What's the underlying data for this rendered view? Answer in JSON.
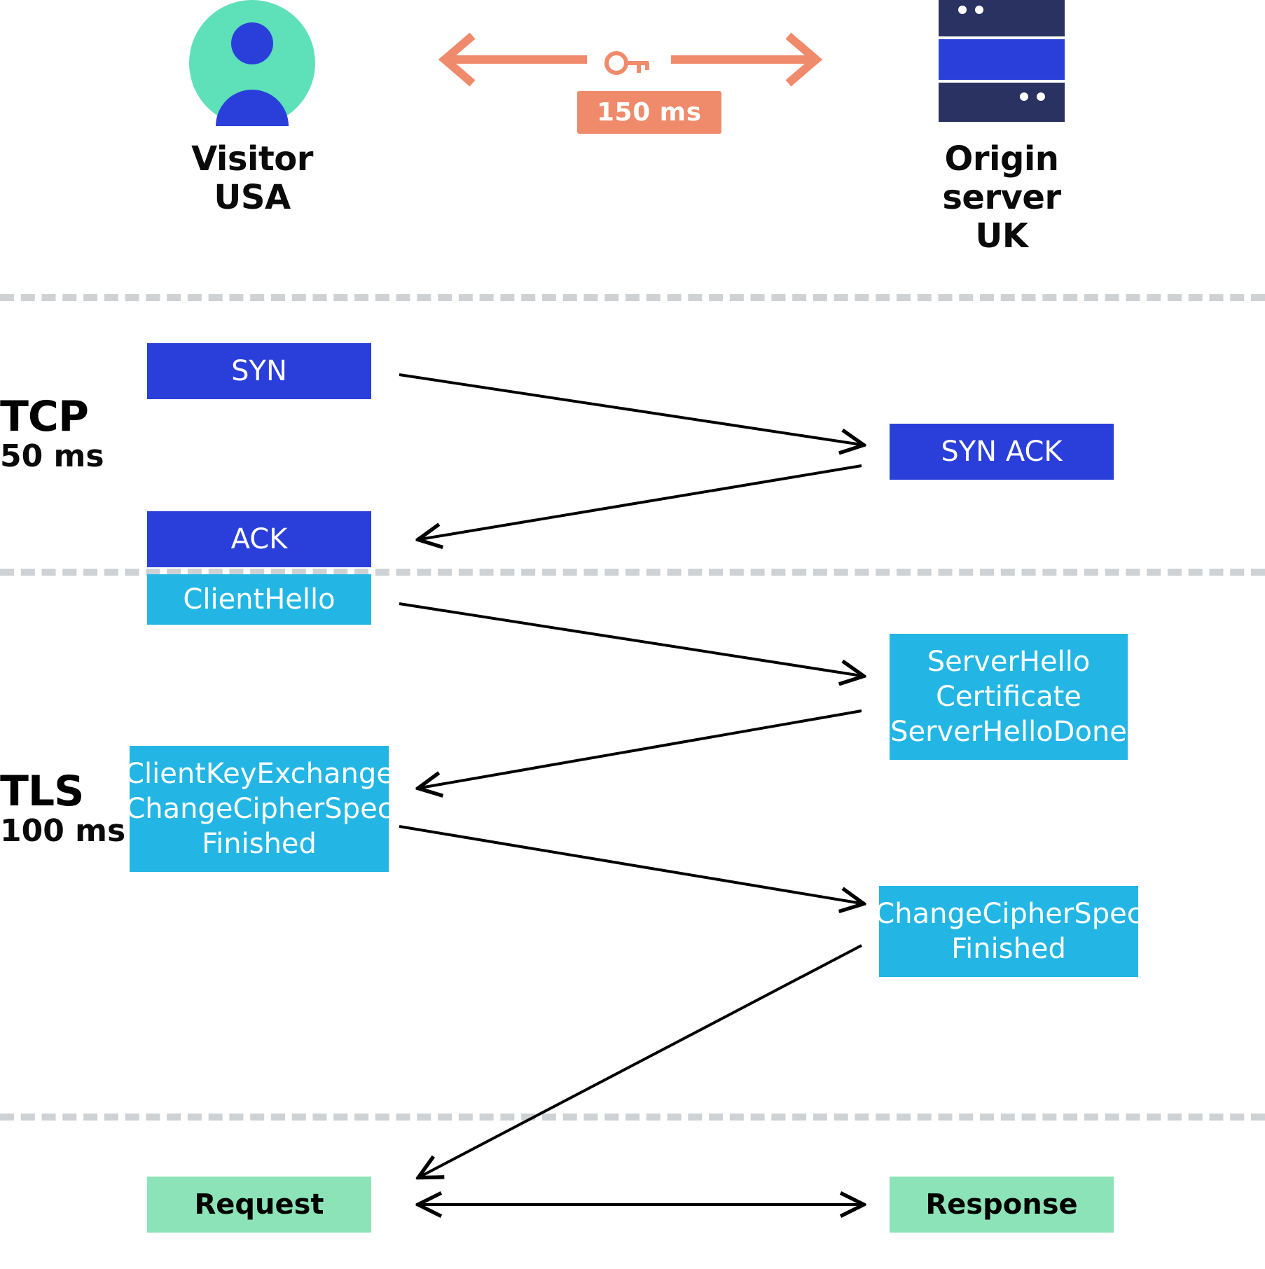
{
  "header": {
    "visitor_label_line1": "Visitor",
    "visitor_label_line2": "USA",
    "origin_label_line1": "Origin server",
    "origin_label_line2": "UK",
    "rtt_label": "150 ms"
  },
  "phases": {
    "tcp": {
      "title": "TCP",
      "time": "50 ms"
    },
    "tls": {
      "title": "TLS",
      "time": "100 ms"
    }
  },
  "messages": {
    "syn": "SYN",
    "synack": "SYN ACK",
    "ack": "ACK",
    "clienthello": "ClientHello",
    "serverhello": "ServerHello\nCertificate\nServerHelloDone",
    "clientkey": "ClientKeyExchange\nChangeCipherSpec\nFinished",
    "serverfinish": "ChangeCipherSpec\nFinished",
    "request": "Request",
    "response": "Response"
  },
  "colors": {
    "blue": "#2a3fda",
    "navy": "#2a3262",
    "teal": "#5ee0b9",
    "cyan": "#23b6e4",
    "mint": "#8ce3b7",
    "salmon": "#ef8b6a"
  }
}
